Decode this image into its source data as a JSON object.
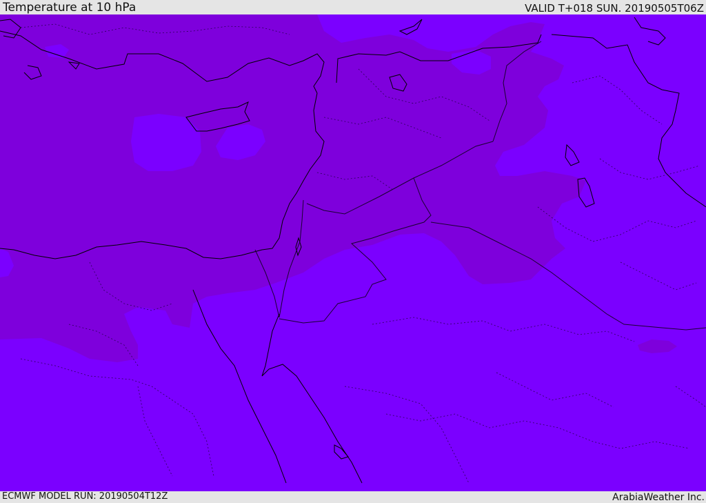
{
  "header": {
    "title": "Temperature at 10 hPa",
    "valid": "VALID T+018 SUN. 20190505T06Z"
  },
  "footer": {
    "model_run": "ECMWF MODEL RUN: 20190504T12Z",
    "credit": "ArabiaWeather Inc."
  },
  "map": {
    "colors": {
      "warm_band": "#7e00dc",
      "cool_band": "#7b00ff",
      "coastline": "#000000",
      "border": "#1a0030"
    }
  }
}
